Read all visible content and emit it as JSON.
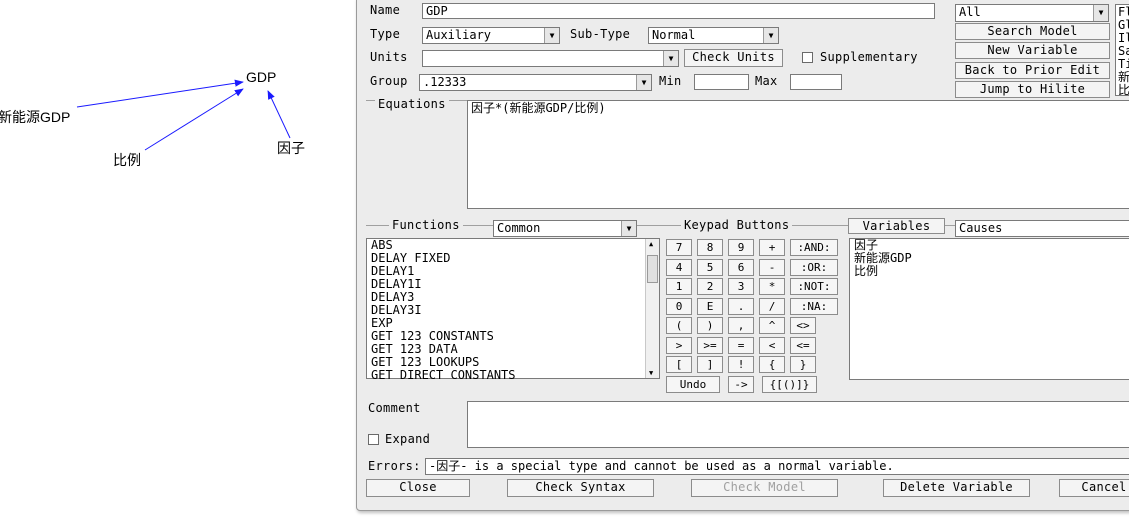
{
  "diagram": {
    "nodes": [
      {
        "id": "gdp",
        "label": "GDP"
      },
      {
        "id": "new_energy_gdp",
        "label": "新能源GDP"
      },
      {
        "id": "ratio",
        "label": "比例"
      },
      {
        "id": "factor",
        "label": "因子"
      }
    ],
    "edges": [
      {
        "from": "new_energy_gdp",
        "to": "gdp"
      },
      {
        "from": "ratio",
        "to": "gdp"
      },
      {
        "from": "factor",
        "to": "gdp"
      }
    ],
    "arrow_color": "#1a1aff"
  },
  "editor": {
    "name_label": "Name",
    "name_value": "GDP",
    "type_label": "Type",
    "type_value": "Auxiliary",
    "subtype_label": "Sub-Type",
    "subtype_value": "Normal",
    "units_label": "Units",
    "units_value": "",
    "check_units_button": "Check Units",
    "supplementary_label": "Supplementary",
    "group_label": "Group",
    "group_value": ".12333",
    "min_label": "Min",
    "max_label": "Max",
    "right_select_value": "All",
    "search_model_button": "Search Model",
    "new_variable_button": "New Variable",
    "back_to_prior_edit_button": "Back to Prior Edit",
    "jump_to_hilite_button": "Jump to Hilite",
    "right_list_partial": [
      "Fl",
      "Gl",
      "Il",
      "Sa",
      "Ti",
      "新",
      "比"
    ],
    "equations_label": "Equations",
    "equation_text": "因子*(新能源GDP/比例)",
    "functions_label": "Functions",
    "functions_category": "Common",
    "functions_list": [
      "ABS",
      "DELAY FIXED",
      "DELAY1",
      "DELAY1I",
      "DELAY3",
      "DELAY3I",
      "EXP",
      "GET 123 CONSTANTS",
      "GET 123 DATA",
      "GET 123 LOOKUPS",
      "GET DIRECT CONSTANTS"
    ],
    "keypad_label": "Keypad Buttons",
    "keypad_rows": [
      [
        "7",
        "8",
        "9",
        "+",
        ":AND:"
      ],
      [
        "4",
        "5",
        "6",
        "-",
        ":OR:"
      ],
      [
        "1",
        "2",
        "3",
        "*",
        ":NOT:"
      ],
      [
        "0",
        "E",
        ".",
        "/",
        ":NA:"
      ],
      [
        "(",
        ")",
        ",",
        "^",
        "<>"
      ],
      [
        ">",
        ">=",
        "=",
        "<",
        "<="
      ],
      [
        "[",
        "]",
        "!",
        "{",
        "}"
      ]
    ],
    "keypad_undo": "Undo",
    "keypad_arrow": "->",
    "keypad_braces": "{[()]}",
    "variables_button": "Variables",
    "variables_select": "Causes",
    "variables_list": [
      "因子",
      "新能源GDP",
      "比例"
    ],
    "comment_label": "Comment",
    "expand_label": "Expand",
    "errors_label": "Errors:",
    "errors_text": "-因子- is a special type and cannot be used as a normal variable.",
    "close_button": "Close",
    "check_syntax_button": "Check Syntax",
    "check_model_button": "Check Model",
    "delete_variable_button": "Delete Variable",
    "cancel_button": "Cancel"
  }
}
